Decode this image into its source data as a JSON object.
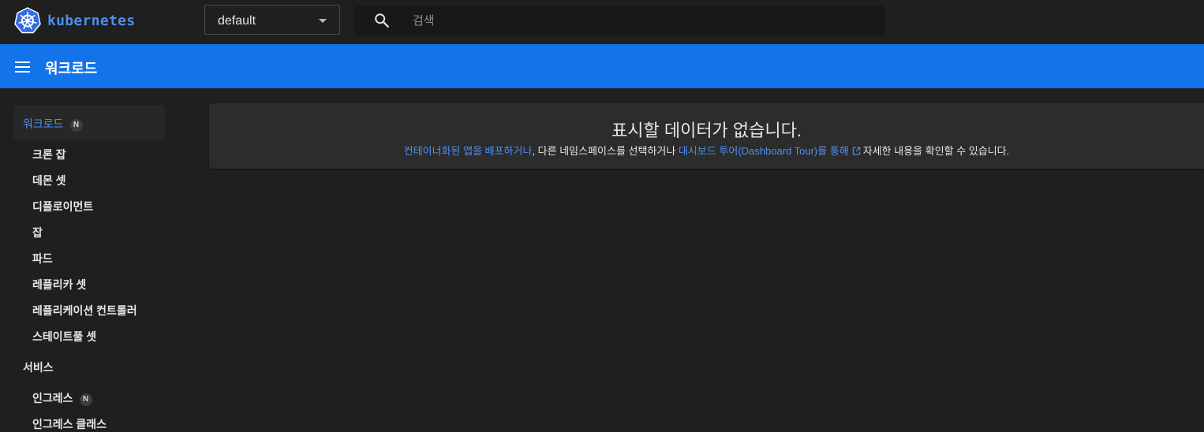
{
  "brand": {
    "name": "kubernetes",
    "logo_icon": "kubernetes-wheel-icon",
    "color": "#326ce5"
  },
  "namespace": {
    "selected": "default"
  },
  "search": {
    "placeholder": "검색",
    "value": ""
  },
  "appbar": {
    "title": "워크로드",
    "color": "#1373e8"
  },
  "sidebar": {
    "group": {
      "label": "워크로드",
      "badge": "N"
    },
    "items": [
      {
        "label": "크론 잡"
      },
      {
        "label": "데몬 셋"
      },
      {
        "label": "디플로이먼트"
      },
      {
        "label": "잡"
      },
      {
        "label": "파드"
      },
      {
        "label": "레플리카 셋"
      },
      {
        "label": "레플리케이션 컨트롤러"
      },
      {
        "label": "스테이트풀 셋"
      }
    ],
    "section2": {
      "label": "서비스"
    },
    "items2": [
      {
        "label": "인그레스",
        "badge": "N"
      },
      {
        "label": "인그레스 클래스"
      }
    ]
  },
  "empty_state": {
    "title": "표시할 데이터가 없습니다.",
    "link1": "컨테이너화된 앱을 배포하거나",
    "text1": ", 다른 네임스페이스를 선택하거나 ",
    "link2": "대시보드 투어(Dashboard Tour)를 통해",
    "text2": "자세한 내용을 확인할 수 있습니다."
  },
  "colors": {
    "accent": "#4d8ef0",
    "background": "#1f1f1f",
    "card": "#2c2c2c"
  }
}
